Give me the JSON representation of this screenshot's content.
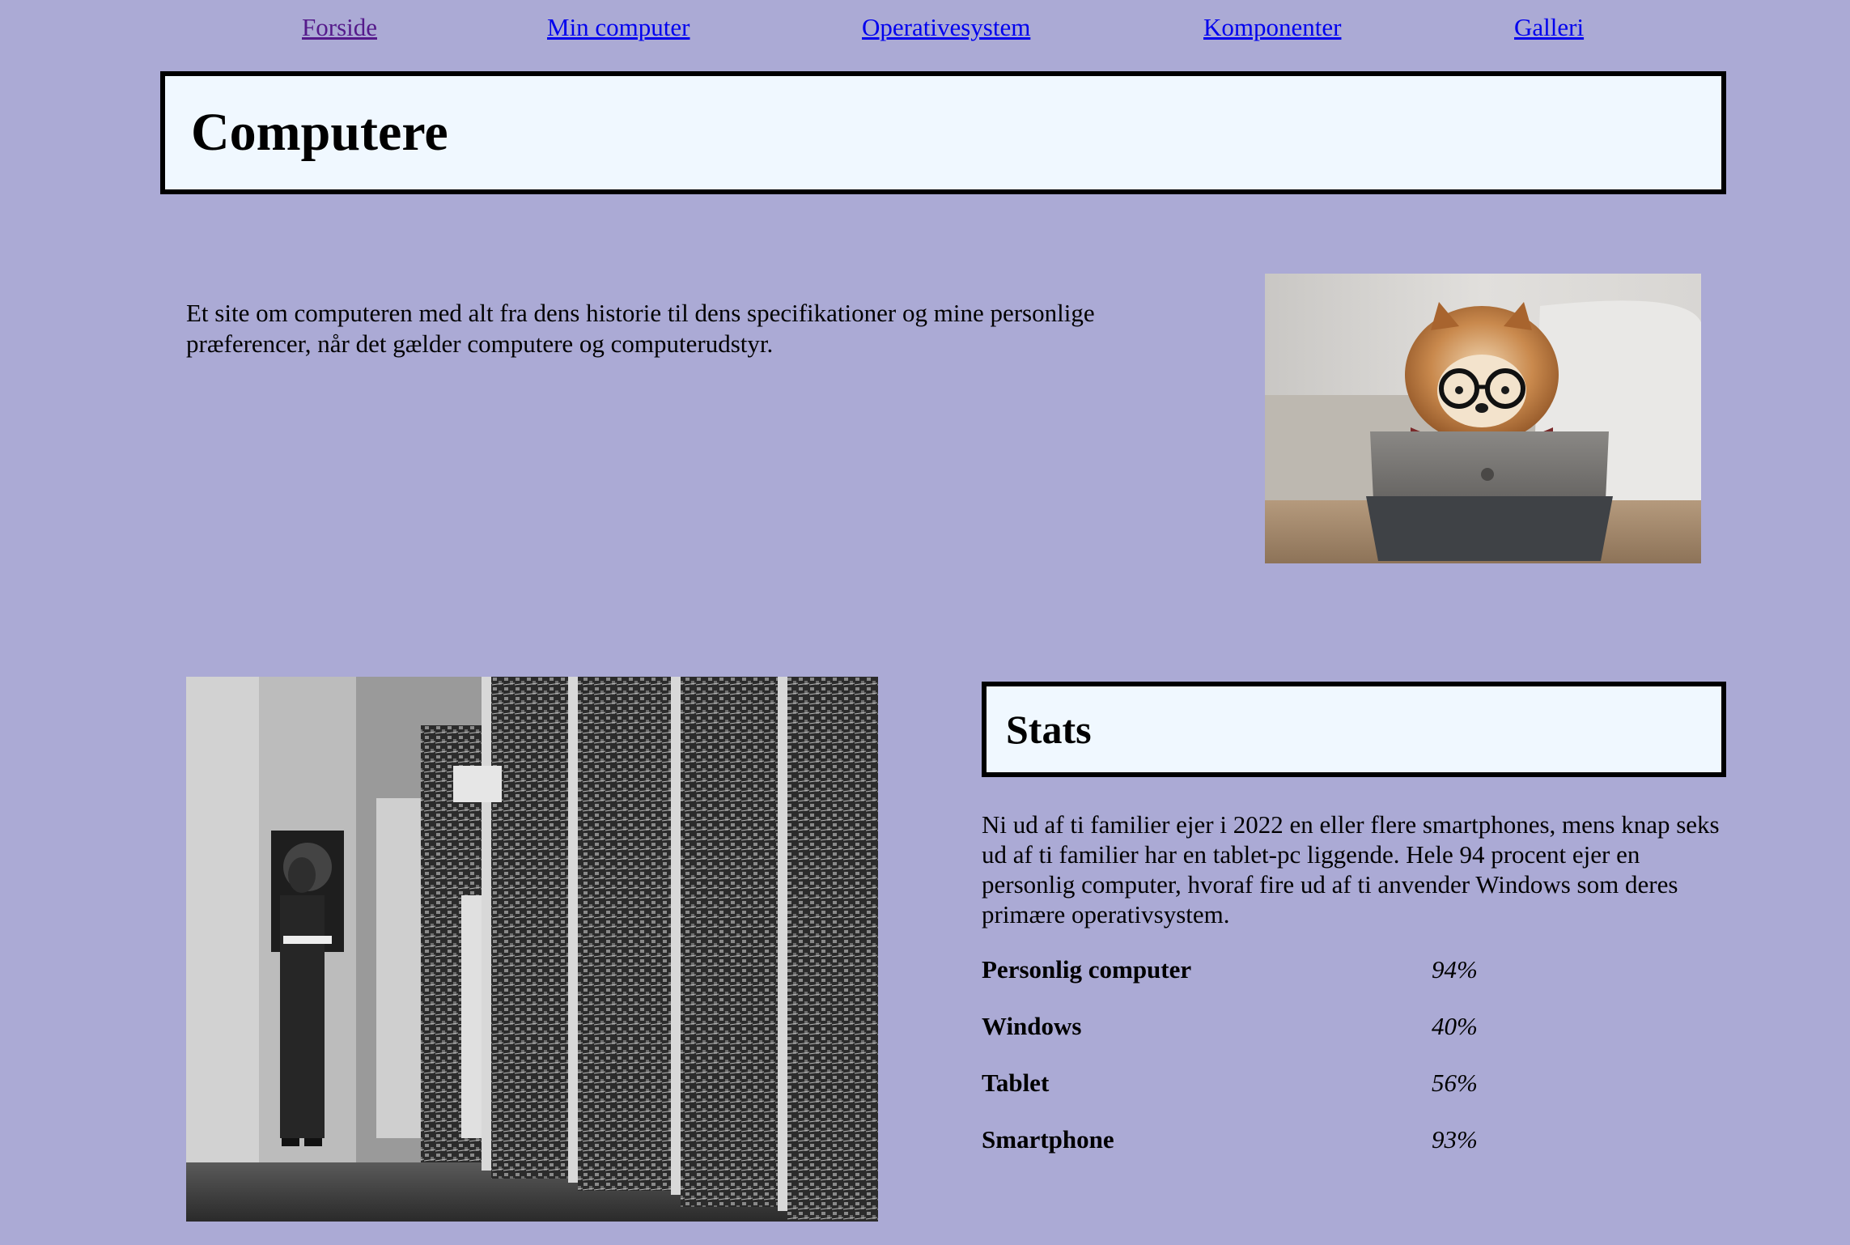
{
  "nav": {
    "items": [
      {
        "label": "Forside",
        "visited": true
      },
      {
        "label": "Min computer",
        "visited": false
      },
      {
        "label": "Operativesystem",
        "visited": false
      },
      {
        "label": "Komponenter",
        "visited": false
      },
      {
        "label": "Galleri",
        "visited": false
      }
    ]
  },
  "header": {
    "title": "Computere"
  },
  "intro": {
    "text": "Et site om computeren med alt fra dens historie til dens specifikationer og mine personlige præferencer, når det gælder computere og computerudstyr."
  },
  "images": {
    "dog_photo": "dog-with-glasses-using-tablet",
    "eniac_photo": "vintage-mainframe-computer-with-man"
  },
  "stats": {
    "title": "Stats",
    "text": "Ni ud af ti familier ejer i 2022 en eller flere smartphones, mens knap seks ud af ti familier har en tablet-pc liggende. Hele 94 procent ejer en personlig computer, hvoraf fire ud af ti anvender Windows som deres primære operativsystem.",
    "rows": [
      {
        "label": "Personlig computer",
        "value": "94%"
      },
      {
        "label": "Windows",
        "value": "40%"
      },
      {
        "label": "Tablet",
        "value": "56%"
      },
      {
        "label": "Smartphone",
        "value": "93%"
      }
    ]
  },
  "colors": {
    "background": "#abaad5",
    "box_fill": "#f0f8ff",
    "link": "#0000ee",
    "visited_link": "#551a8b"
  }
}
